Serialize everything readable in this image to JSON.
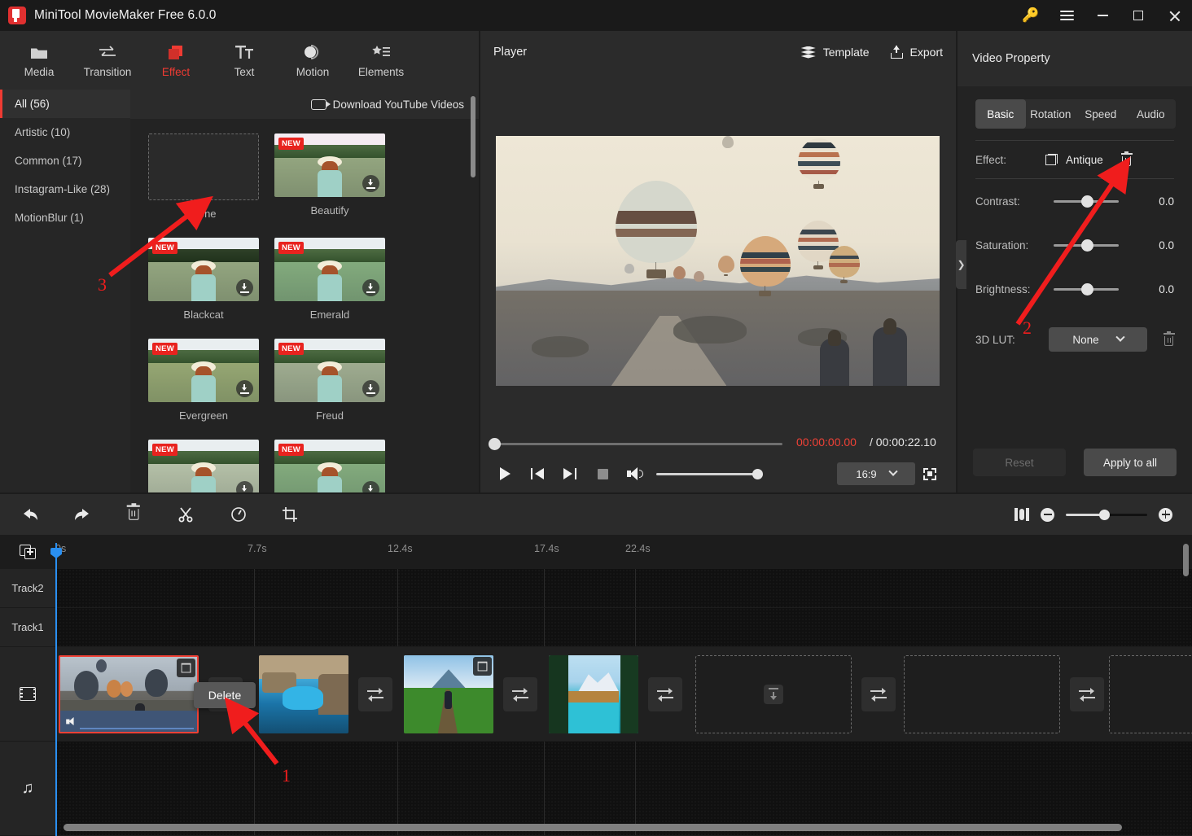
{
  "window": {
    "title": "MiniTool MovieMaker Free 6.0.0",
    "controls": {
      "key": "key-icon",
      "menu": "hamburger-icon",
      "minimize": "−",
      "maximize": "□",
      "close": "✕"
    }
  },
  "nav": {
    "items": [
      {
        "label": "Media",
        "icon": "folder-icon",
        "active": false
      },
      {
        "label": "Transition",
        "icon": "transition-arrows-icon",
        "active": false
      },
      {
        "label": "Effect",
        "icon": "effect-squares-icon",
        "active": true
      },
      {
        "label": "Text",
        "icon": "text-icon",
        "active": false
      },
      {
        "label": "Motion",
        "icon": "motion-icon",
        "active": false
      },
      {
        "label": "Elements",
        "icon": "elements-star-icon",
        "active": false
      }
    ],
    "active_color": "#ef3b33"
  },
  "effects_panel": {
    "categories": [
      {
        "label": "All (56)",
        "active": true
      },
      {
        "label": "Artistic (10)",
        "active": false
      },
      {
        "label": "Common (17)",
        "active": false
      },
      {
        "label": "Instagram-Like (28)",
        "active": false
      },
      {
        "label": "MotionBlur (1)",
        "active": false
      }
    ],
    "download_link": "Download YouTube Videos",
    "new_badge": "NEW",
    "items": [
      {
        "label": "None",
        "is_none": true,
        "new": false,
        "downloadable": false,
        "tone": ""
      },
      {
        "label": "Beautify",
        "is_none": false,
        "new": true,
        "downloadable": true,
        "tone": "tone-beautify"
      },
      {
        "label": "Blackcat",
        "is_none": false,
        "new": true,
        "downloadable": true,
        "tone": "tone-blackcat"
      },
      {
        "label": "Emerald",
        "is_none": false,
        "new": true,
        "downloadable": true,
        "tone": "tone-emerald"
      },
      {
        "label": "Evergreen",
        "is_none": false,
        "new": true,
        "downloadable": true,
        "tone": "tone-evergreen"
      },
      {
        "label": "Freud",
        "is_none": false,
        "new": true,
        "downloadable": true,
        "tone": "tone-freud"
      },
      {
        "label": "",
        "is_none": false,
        "new": true,
        "downloadable": true,
        "tone": "tone-pale"
      },
      {
        "label": "",
        "is_none": false,
        "new": true,
        "downloadable": true,
        "tone": "tone-emerald"
      }
    ]
  },
  "player": {
    "title": "Player",
    "template_label": "Template",
    "export_label": "Export",
    "current_time": "00:00:00.00",
    "total_time": "/ 00:00:22.10",
    "aspect_ratio": "16:9",
    "time_color": "#ef4136",
    "scene_alt": "hot-air-balloons-cappadocia-antique-effect"
  },
  "video_property": {
    "title": "Video Property",
    "tabs": [
      {
        "label": "Basic",
        "active": true
      },
      {
        "label": "Rotation",
        "active": false
      },
      {
        "label": "Speed",
        "active": false
      },
      {
        "label": "Audio",
        "active": false
      }
    ],
    "effect_label": "Effect:",
    "effect_value": "Antique",
    "sliders": [
      {
        "label": "Contrast:",
        "value": "0.0"
      },
      {
        "label": "Saturation:",
        "value": "0.0"
      },
      {
        "label": "Brightness:",
        "value": "0.0"
      }
    ],
    "lut_label": "3D LUT:",
    "lut_value": "None",
    "reset_label": "Reset",
    "apply_label": "Apply to all"
  },
  "timeline_toolbar": {
    "buttons": [
      {
        "name": "undo-button",
        "icon": "undo-arrow-icon"
      },
      {
        "name": "redo-button",
        "icon": "redo-arrow-icon"
      },
      {
        "name": "delete-button",
        "icon": "trash-icon"
      },
      {
        "name": "split-button",
        "icon": "scissors-icon"
      },
      {
        "name": "speed-button",
        "icon": "speedometer-icon"
      },
      {
        "name": "crop-button",
        "icon": "crop-icon"
      }
    ]
  },
  "timeline": {
    "ruler_ticks": [
      "0s",
      "7.7s",
      "12.4s",
      "17.4s",
      "22.4s"
    ],
    "track_labels": [
      "Track2",
      "Track1"
    ],
    "video_track_icon": "film-strip-icon",
    "audio_track_icon": "music-note-icon",
    "add_media_icon": "add-media-icon",
    "clips": [
      {
        "name": "balloons-clip",
        "selected": true,
        "has_audio": true,
        "has_badge": true
      },
      {
        "name": "lagoon-clip",
        "selected": false,
        "has_audio": false,
        "has_badge": false
      },
      {
        "name": "biker-clip",
        "selected": false,
        "has_audio": false,
        "has_badge": true
      },
      {
        "name": "mountain-lake-clip",
        "selected": false,
        "has_audio": false,
        "has_badge": false
      }
    ],
    "empty_slots": 2,
    "transition_buttons": 5
  },
  "context_menu": {
    "delete_label": "Delete"
  },
  "annotations": [
    {
      "number": "1",
      "target": "delete-tooltip"
    },
    {
      "number": "2",
      "target": "effect-delete-icon"
    },
    {
      "number": "3",
      "target": "none-effect-tile"
    }
  ]
}
